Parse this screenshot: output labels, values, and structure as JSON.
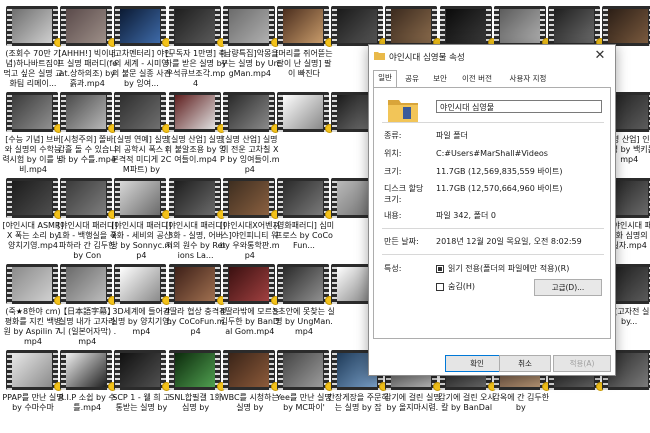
{
  "files": [
    {
      "name": "(조회수 70만 기념)하나바트짐이 먹고 싶은 실명 교화팀 리메이...",
      "c1": "#6e6e6e",
      "c2": "#cfcfcf"
    },
    {
      "name": "[AHHH!] 빅이너프 실명 패러디(feat.상하의조) by 흙과.mp4",
      "c1": "#5a4a4a",
      "c2": "#9d8f88"
    },
    {
      "name": "[고차멘터리] 야인의 세계 - 시미영의 불문 실종 사건 by 잉여...",
      "c1": "#0b1a33",
      "c2": "#3e6aa8"
    },
    {
      "name": "[구독자 1만명] 축하를 받은 실명 by 우석큐브조각.mp4",
      "c1": "#1e1e1e",
      "c2": "#5a5a5a"
    },
    {
      "name": "[납량특집]악몽을 꾸는 실명 by UngMan.mp4",
      "c1": "#6b6b6b",
      "c2": "#b0b0b0"
    },
    {
      "name": "[머리를 쥐어뜯는 팔이 난 실명] 팔이 빠진다",
      "c1": "#4b2e1e",
      "c2": "#c89b6a"
    },
    {
      "name": "",
      "c1": "#1a1a1a",
      "c2": "#555555"
    },
    {
      "name": "",
      "c1": "#3b2a1e",
      "c2": "#8a6b4c"
    },
    {
      "name": "",
      "c1": "#0a0a0a",
      "c2": "#3a3a3a"
    },
    {
      "name": "",
      "c1": "#5c5c5c",
      "c2": "#adadad"
    },
    {
      "name": "",
      "c1": "#1f1f1f",
      "c2": "#6b6b6b"
    },
    {
      "name": "",
      "c1": "#2b1e16",
      "c2": "#7a5a3e"
    },
    {
      "name": "[수능 기념] 브버와 실명의 수학능력시험 by 이를 낭비.mp4",
      "c1": "#3a3a3a",
      "c2": "#909090"
    },
    {
      "name": "[시청주의] 쫄바 감흘 돌 수 있습니다 by 수틀.mp4",
      "c1": "#4a4a4a",
      "c2": "#b8b8b8"
    },
    {
      "name": "[실명 연예] 실명의 공학시 폭스 ( 본격적 미디게 2CM파트) by",
      "c1": "#2e2e2e",
      "c2": "#6f6f6f"
    },
    {
      "name": "[실명 산업] 실명의 불알조용 by 잉여들이.mp4",
      "c1": "#5f1e1e",
      "c2": "#e0e0e0"
    },
    {
      "name": "[실명 산업] 실명이 전운 고차칠 XP by 잉여들이.mp4",
      "c1": "#2a2a2a",
      "c2": "#8a8a8a"
    },
    {
      "name": "",
      "c1": "#ffffff",
      "c2": "#888888"
    },
    {
      "name": "",
      "c1": "#1a1a1a",
      "c2": "#777777"
    },
    {
      "name": "",
      "c1": "#3a3a3a",
      "c2": "#9a9a9a"
    },
    {
      "name": "",
      "c1": "#5a5a5a",
      "c2": "#b5b5b5"
    },
    {
      "name": "",
      "c1": "#2d2d2d",
      "c2": "#6a6a6a"
    },
    {
      "name": "",
      "c1": "#444444",
      "c2": "#999999"
    },
    {
      "name": "[실명 산업] 인어 실명 by 백키를 mp4",
      "c1": "#1e1e1e",
      "c2": "#5c5c5c"
    },
    {
      "name": "[야인시대 ASMR] X 폭는 소리 by 양치기영.mp4",
      "c1": "#1c1c1c",
      "c2": "#4e4e4e"
    },
    {
      "name": "[야인시대 패러디] 1화 - 백행실을 폭파하라 간 김두한 by Con",
      "c1": "#3b3b3b",
      "c2": "#7e7e7e"
    },
    {
      "name": "[야인시대 패러디] 2화 - 세비의 공산당 by Sonnyc.mp4",
      "c1": "#d8d8d8",
      "c2": "#6a6a6a"
    },
    {
      "name": "[야인시대 패러디] 3화 - 실명, 어버지의 원수 by Retions La...",
      "c1": "#1e1e1e",
      "c2": "#6a6a6a"
    },
    {
      "name": "[야인시대X어벤져스]야인피니티 워 by 우와통학판.mp4",
      "c1": "#3e2e20",
      "c2": "#8a6040"
    },
    {
      "name": "[영화패러디] 심미프로스 by CoCoFun...",
      "c1": "#2a2a2a",
      "c2": "#7a7a7a"
    },
    {
      "name": "",
      "c1": "#bababa",
      "c2": "#6b6b6b"
    },
    {
      "name": "",
      "c1": "#0c0c0c",
      "c2": "#4c4c4c"
    },
    {
      "name": "",
      "c1": "#2f2f2f",
      "c2": "#8a8a8a"
    },
    {
      "name": "",
      "c1": "#1f1f1f",
      "c2": "#626262"
    },
    {
      "name": "",
      "c1": "#404040",
      "c2": "#909090"
    },
    {
      "name": "(리)야인시대 패러디 만화 심명의 by 실자.mp4",
      "c1": "#1f1f1f",
      "c2": "#6a6a6a"
    },
    {
      "name": "(죽★8한야 cm) 평화를 지킨 백병원 by Aspilin 7.mp4",
      "c1": "#8a8a8a",
      "c2": "#d0d0d0"
    },
    {
      "name": "【日本語字幕】실명 내가 고자라니 (일본어자막) .mp4",
      "c1": "#6a6a6a",
      "c2": "#bcbcbc"
    },
    {
      "name": "3D세계에 들어간 실명 by 양치기영.mp4",
      "c1": "#ffffff",
      "c2": "#8a8a8a"
    },
    {
      "name": "4딸라 협상 충격전 by CoCoFun.mp4",
      "c1": "#3e2018",
      "c2": "#a07050"
    },
    {
      "name": "4딸라밖에 모르는 김두한 by BanDal Gom.mp4",
      "c1": "#3a1010",
      "c2": "#a04040"
    },
    {
      "name": "5초안에 못찾는 실명 by UngMan.mp4",
      "c1": "#2a2a2a",
      "c2": "#909090"
    },
    {
      "name": "",
      "c1": "#ffffff",
      "c2": "#7a7a7a"
    },
    {
      "name": "",
      "c1": "#1a1a1a",
      "c2": "#6a6a6a"
    },
    {
      "name": "",
      "c1": "#f5f5f5",
      "c2": "#9a9a9a"
    },
    {
      "name": "",
      "c1": "#2a2a2a",
      "c2": "#7a7a7a"
    },
    {
      "name": "",
      "c1": "#141414",
      "c2": "#555555"
    },
    {
      "name": "SY (고자전 실명 by...",
      "c1": "#1a1a1a",
      "c2": "#5a5a5a"
    },
    {
      "name": "PPAP를 만난 실명 by 수마수마",
      "c1": "#e8e8e8",
      "c2": "#8a8a8a"
    },
    {
      "name": "R.I.P 소쉽 by 수틀.mp4",
      "c1": "#f0f0f0",
      "c2": "#202020"
    },
    {
      "name": "SCP 1 - 웰 희 고통받는 실명 by",
      "c1": "#101010",
      "c2": "#505050"
    },
    {
      "name": "SNL합필갤 1화 심명 by",
      "c1": "#0c2a0c",
      "c2": "#50a050"
    },
    {
      "name": "WBC를 시청하는 실명 by",
      "c1": "#3a2418",
      "c2": "#8c5a3a"
    },
    {
      "name": "Yee를 만난 실명 by MC파이'",
      "c1": "#444444",
      "c2": "#9c9c9c"
    },
    {
      "name": "간장게장을 주문하는 실명 by 잡",
      "c1": "#1e3a58",
      "c2": "#7aa0c8"
    },
    {
      "name": "감기에 걸린 실명 by 올지마시렴.",
      "c1": "#5a5a5a",
      "c2": "#b0b0b0"
    },
    {
      "name": "감기에 걸린 오사칼 by BanDal",
      "c1": "#222222",
      "c2": "#666666"
    },
    {
      "name": "감옥에 간 김두한 by",
      "c1": "#6a5040",
      "c2": "#b09070"
    },
    {
      "name": "",
      "c1": "#1f1f1f",
      "c2": "#5f5f5f"
    },
    {
      "name": "",
      "c1": "#2a2a2a",
      "c2": "#7a7a7a"
    }
  ],
  "dialog": {
    "title": "야인시대 심영물 속성",
    "close_glyph": "✕",
    "tabs": [
      "일반",
      "공유",
      "보안",
      "이전 버전",
      "사용자 지정"
    ],
    "folder_name": "야인시대 심영물",
    "rows": [
      {
        "label": "종류:",
        "value": "파일 폴더"
      },
      {
        "label": "위치:",
        "value": "C:#Users#MarShall#Videos"
      },
      {
        "label": "크기:",
        "value": "11.7GB (12,569,835,559 바이트)"
      },
      {
        "label": "디스크 할당 크기:",
        "value": "11.7GB (12,570,664,960 바이트)"
      },
      {
        "label": "내용:",
        "value": "파일 342, 폴더 0"
      },
      {
        "label": "만든 날짜:",
        "value": "2018년 12월 20일 목요일, 오전 8:02:59"
      }
    ],
    "attr_label": "특성:",
    "readonly_label": "읽기 전용(폴더의 파일에만 적용)(R)",
    "hidden_label": "숨김(H)",
    "advanced_label": "고급(D)...",
    "ok_label": "확인",
    "cancel_label": "취소",
    "apply_label": "적용(A)"
  },
  "colors": {
    "badge": "#f3c21a",
    "folder": "#e9b949",
    "accent": "#0078d7"
  }
}
